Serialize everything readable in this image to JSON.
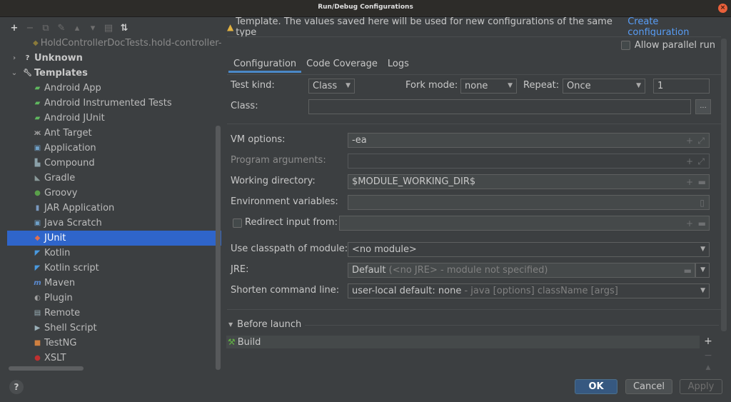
{
  "window": {
    "title": "Run/Debug Configurations"
  },
  "toolbar": {
    "icons": [
      "add-icon",
      "remove-icon",
      "copy-icon",
      "wrench-icon",
      "move-up-icon",
      "move-down-icon",
      "folder-icon",
      "sort-icon"
    ]
  },
  "tree": {
    "items": [
      {
        "label": "HoldControllerDocTests.hold-controller-",
        "level": 2,
        "icon": "junit-icon",
        "dim": true
      },
      {
        "label": "Unknown",
        "level": 0,
        "icon": "question-icon",
        "bold": true,
        "expanded": false
      },
      {
        "label": "Templates",
        "level": 0,
        "icon": "wrench-icon",
        "bold": true,
        "expanded": true
      },
      {
        "label": "Android App",
        "level": 1,
        "icon": "android-icon"
      },
      {
        "label": "Android Instrumented Tests",
        "level": 1,
        "icon": "android-test-icon"
      },
      {
        "label": "Android JUnit",
        "level": 1,
        "icon": "android-test-icon"
      },
      {
        "label": "Ant Target",
        "level": 1,
        "icon": "ant-icon"
      },
      {
        "label": "Application",
        "level": 1,
        "icon": "application-icon"
      },
      {
        "label": "Compound",
        "level": 1,
        "icon": "compound-icon"
      },
      {
        "label": "Gradle",
        "level": 1,
        "icon": "gradle-icon"
      },
      {
        "label": "Groovy",
        "level": 1,
        "icon": "groovy-icon"
      },
      {
        "label": "JAR Application",
        "level": 1,
        "icon": "jar-icon"
      },
      {
        "label": "Java Scratch",
        "level": 1,
        "icon": "java-scratch-icon"
      },
      {
        "label": "JUnit",
        "level": 1,
        "icon": "junit-icon",
        "selected": true
      },
      {
        "label": "Kotlin",
        "level": 1,
        "icon": "kotlin-icon"
      },
      {
        "label": "Kotlin script",
        "level": 1,
        "icon": "kotlin-icon"
      },
      {
        "label": "Maven",
        "level": 1,
        "icon": "maven-icon"
      },
      {
        "label": "Plugin",
        "level": 1,
        "icon": "plugin-icon"
      },
      {
        "label": "Remote",
        "level": 1,
        "icon": "remote-icon"
      },
      {
        "label": "Shell Script",
        "level": 1,
        "icon": "shell-icon"
      },
      {
        "label": "TestNG",
        "level": 1,
        "icon": "testng-icon"
      },
      {
        "label": "XSLT",
        "level": 1,
        "icon": "xslt-icon"
      }
    ]
  },
  "banner": {
    "text": "Template. The values saved here will be used for new configurations of the same type",
    "link": "Create configuration"
  },
  "allow_parallel": {
    "label": "Allow parallel run",
    "checked": false
  },
  "tabs": [
    {
      "label": "Configuration",
      "active": true
    },
    {
      "label": "Code Coverage",
      "active": false
    },
    {
      "label": "Logs",
      "active": false
    }
  ],
  "form": {
    "test_kind": {
      "label": "Test kind:",
      "value": "Class"
    },
    "fork_mode": {
      "label": "Fork mode:",
      "value": "none"
    },
    "repeat": {
      "label": "Repeat:",
      "value": "Once",
      "count": "1"
    },
    "class": {
      "label": "Class:",
      "value": "",
      "browse": "..."
    },
    "vm_options": {
      "label": "VM options:",
      "value": "-ea"
    },
    "program_arguments": {
      "label": "Program arguments:",
      "value": ""
    },
    "working_directory": {
      "label": "Working directory:",
      "value": "$MODULE_WORKING_DIR$"
    },
    "environment_variables": {
      "label": "Environment variables:",
      "value": ""
    },
    "redirect_input": {
      "label": "Redirect input from:",
      "value": "",
      "checked": false
    },
    "classpath_module": {
      "label": "Use classpath of module:",
      "value": "<no module>"
    },
    "jre": {
      "label": "JRE:",
      "value": "Default",
      "hint": "(<no JRE> - module not specified)"
    },
    "shorten_command_line": {
      "label": "Shorten command line:",
      "value": "user-local default: none",
      "hint": "- java [options] className [args]"
    }
  },
  "before_launch": {
    "label": "Before launch",
    "tasks": [
      {
        "label": "Build",
        "icon": "hammer-icon"
      }
    ]
  },
  "buttons": {
    "ok": "OK",
    "cancel": "Cancel",
    "apply": "Apply",
    "help": "?"
  },
  "colors": {
    "accent": "#2f65ca",
    "link": "#589df6",
    "ok": "#365880",
    "warning": "#e3b341",
    "close": "#e9603a"
  }
}
